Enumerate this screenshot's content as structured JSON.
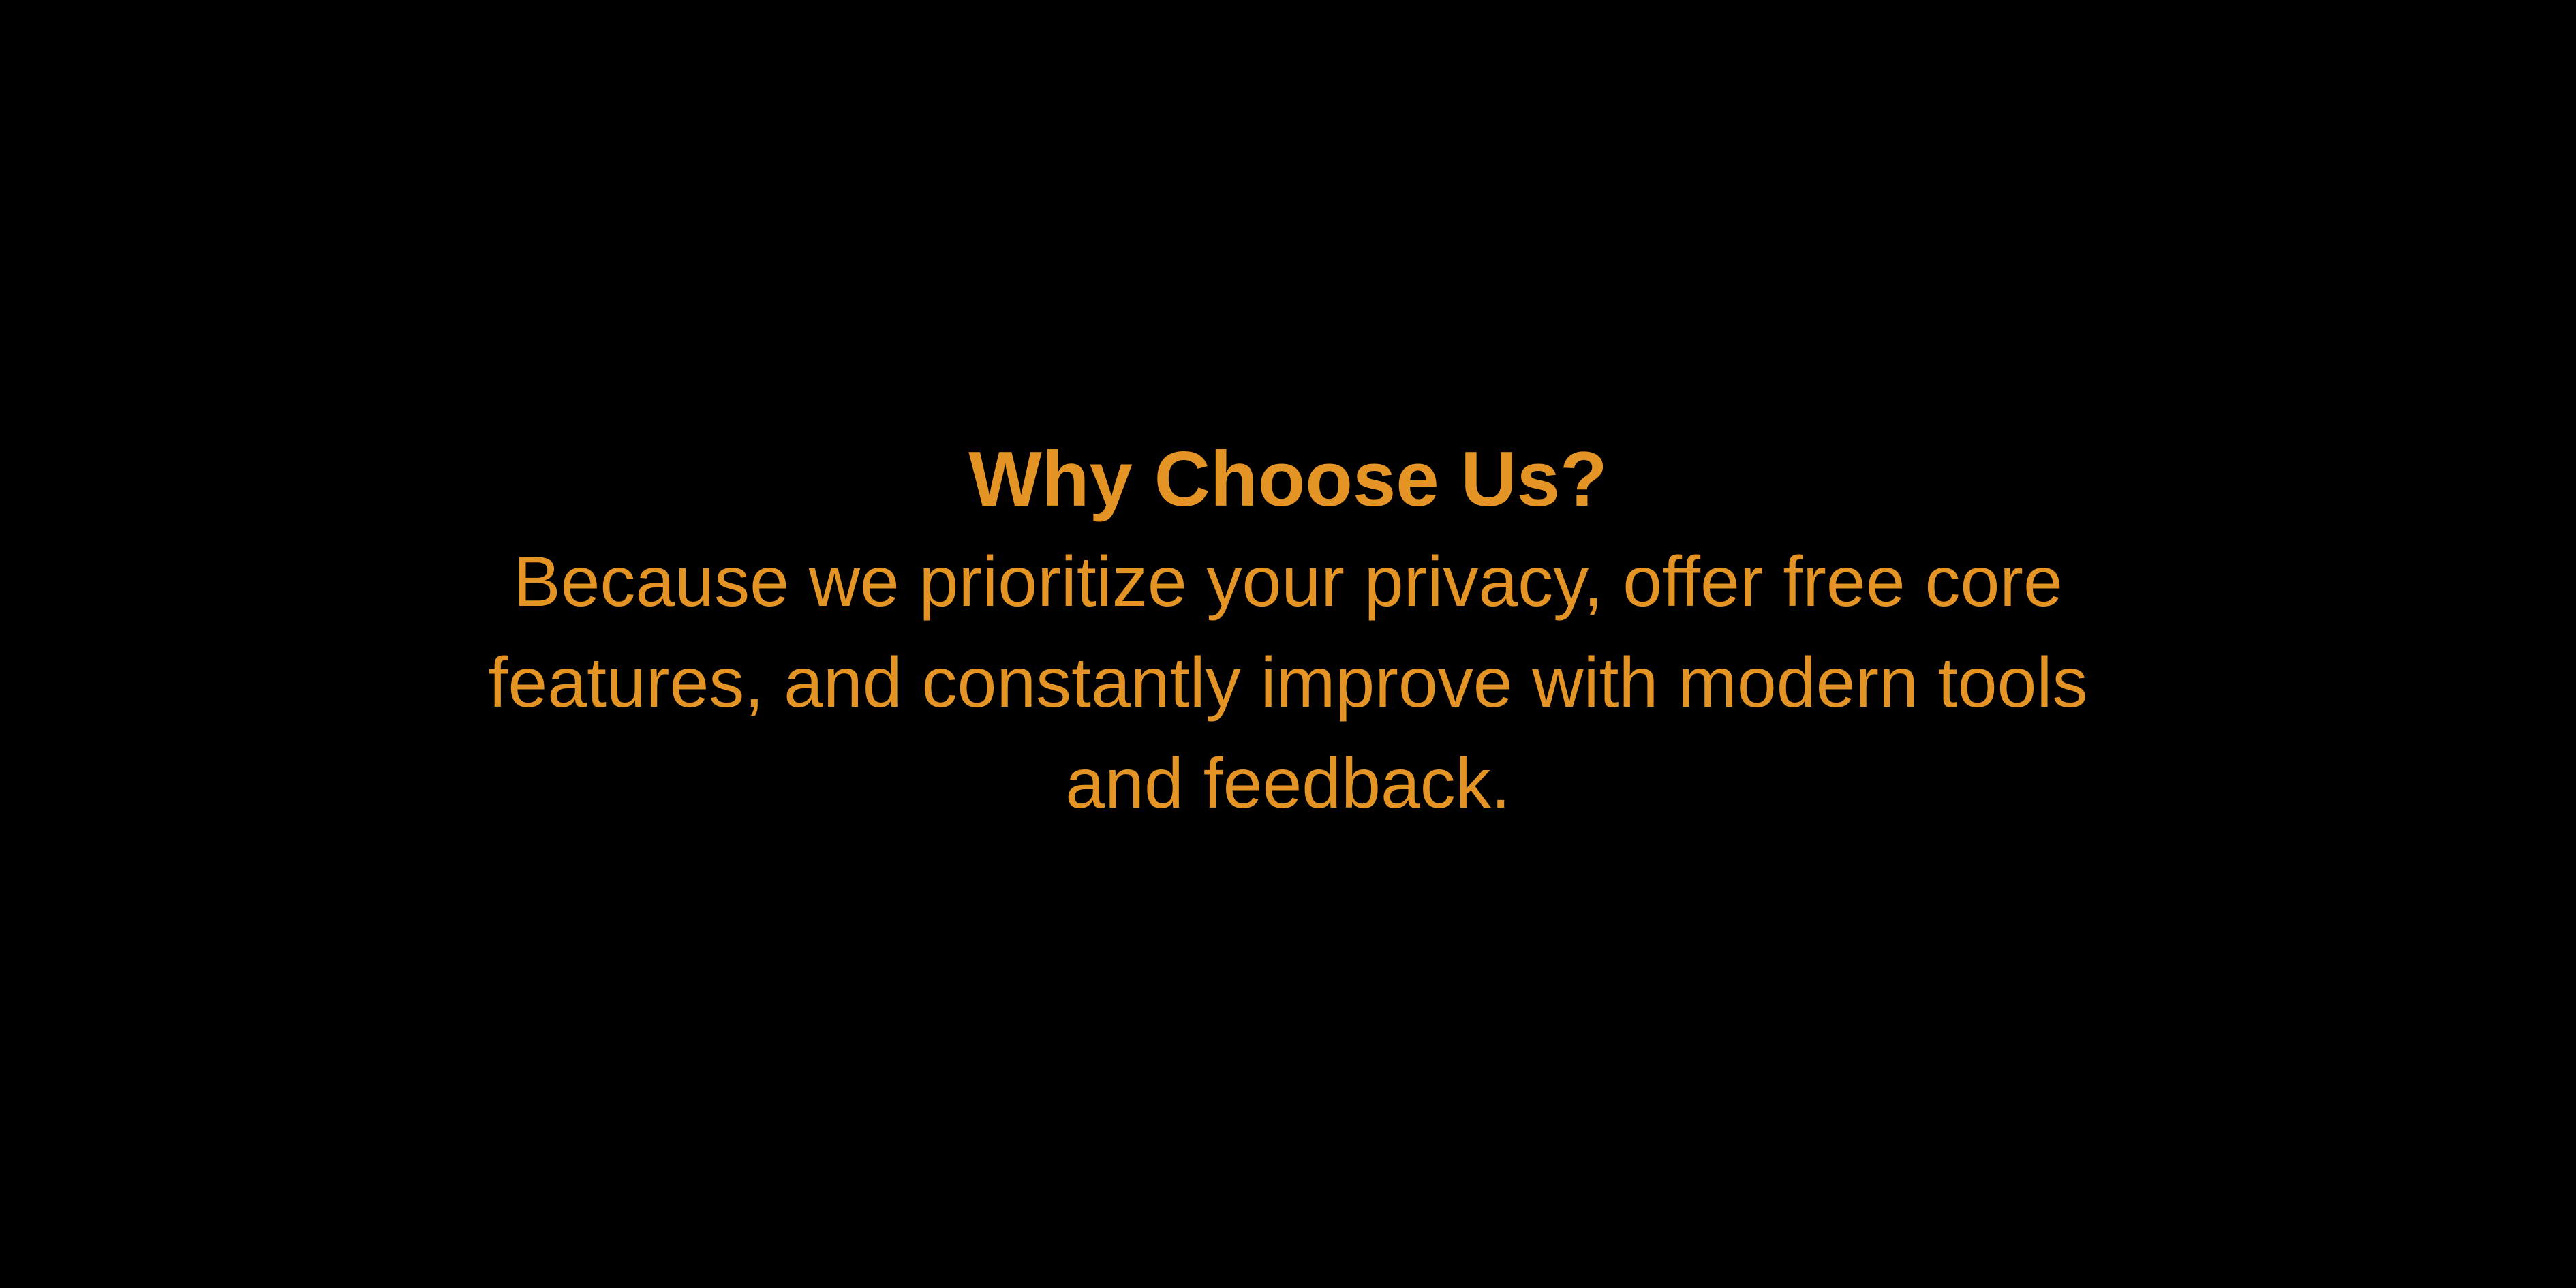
{
  "heading": {
    "title": "Why Choose Us?"
  },
  "body": {
    "lines": [
      "Because we prioritize your privacy, offer free core",
      "features, and constantly improve with modern tools",
      "and feedback."
    ]
  },
  "colors": {
    "background": "#000000",
    "text": "#E39424"
  }
}
